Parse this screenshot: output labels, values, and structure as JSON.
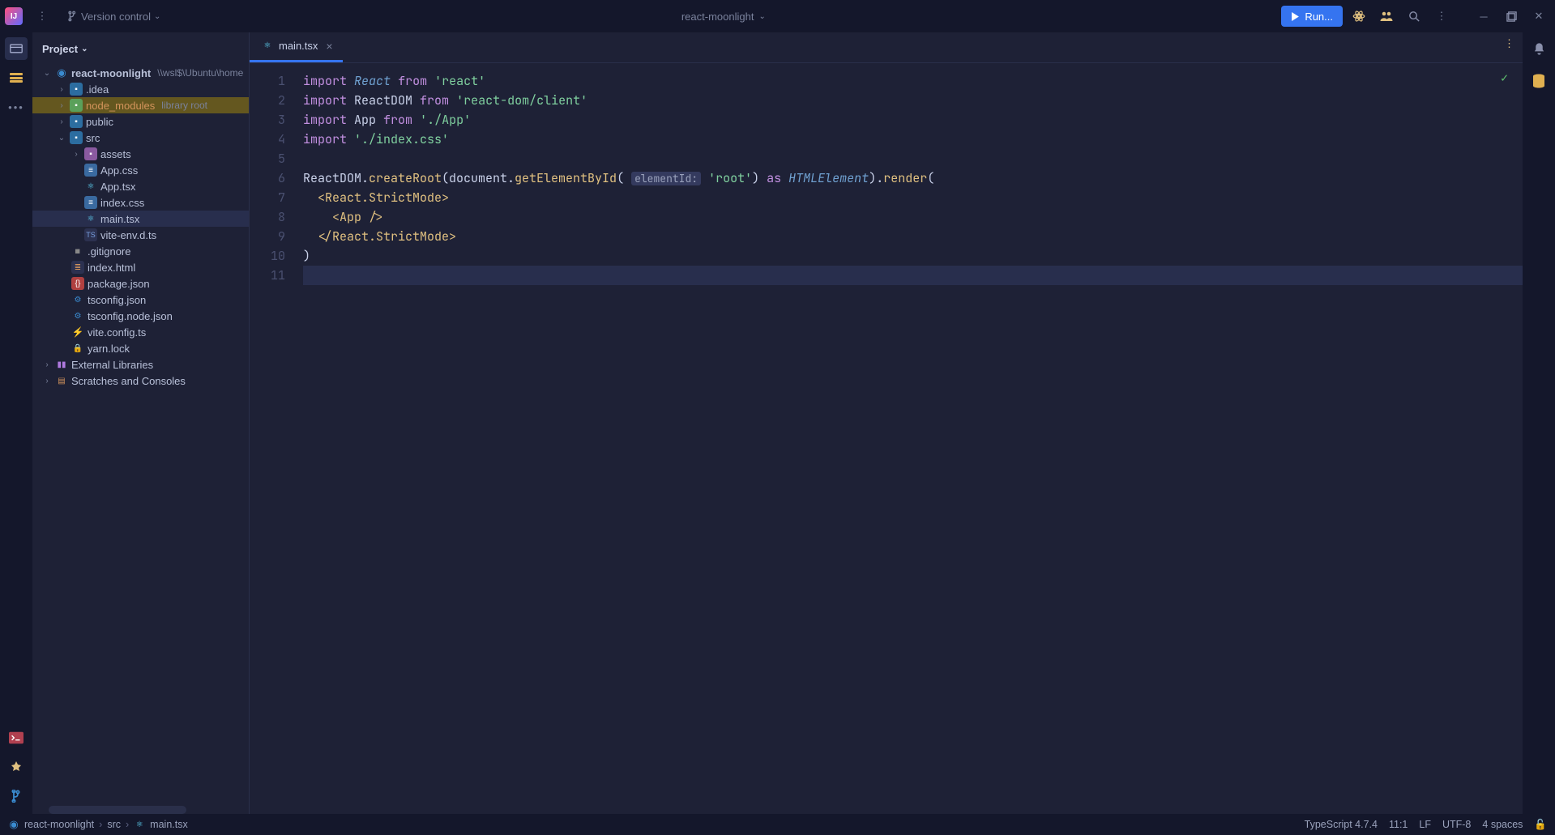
{
  "titlebar": {
    "logo": "IJ",
    "vcs_label": "Version control",
    "project": "react-moonlight",
    "run_label": "Run..."
  },
  "project": {
    "header": "Project",
    "root": {
      "name": "react-moonlight",
      "hint": "\\\\wsl$\\Ubuntu\\home"
    },
    "idea": ".idea",
    "node_modules": "node_modules",
    "node_modules_hint": "library root",
    "public": "public",
    "src": "src",
    "assets": "assets",
    "app_css": "App.css",
    "app_tsx": "App.tsx",
    "index_css": "index.css",
    "main_tsx": "main.tsx",
    "vite_env": "vite-env.d.ts",
    "gitignore": ".gitignore",
    "index_html": "index.html",
    "pkg": "package.json",
    "tscfg": "tsconfig.json",
    "tscfg_node": "tsconfig.node.json",
    "vite_cfg": "vite.config.ts",
    "yarn": "yarn.lock",
    "extlib": "External Libraries",
    "scratch": "Scratches and Consoles"
  },
  "tabs": {
    "main": "main.tsx"
  },
  "code": {
    "hint_elementId": "elementId:",
    "line_numbers": [
      "1",
      "2",
      "3",
      "4",
      "5",
      "6",
      "7",
      "8",
      "9",
      "10",
      "11"
    ]
  },
  "status": {
    "crumb_proj": "react-moonlight",
    "crumb_src": "src",
    "crumb_file": "main.tsx",
    "ts": "TypeScript 4.7.4",
    "pos": "11:1",
    "lf": "LF",
    "enc": "UTF-8",
    "indent": "4 spaces"
  }
}
